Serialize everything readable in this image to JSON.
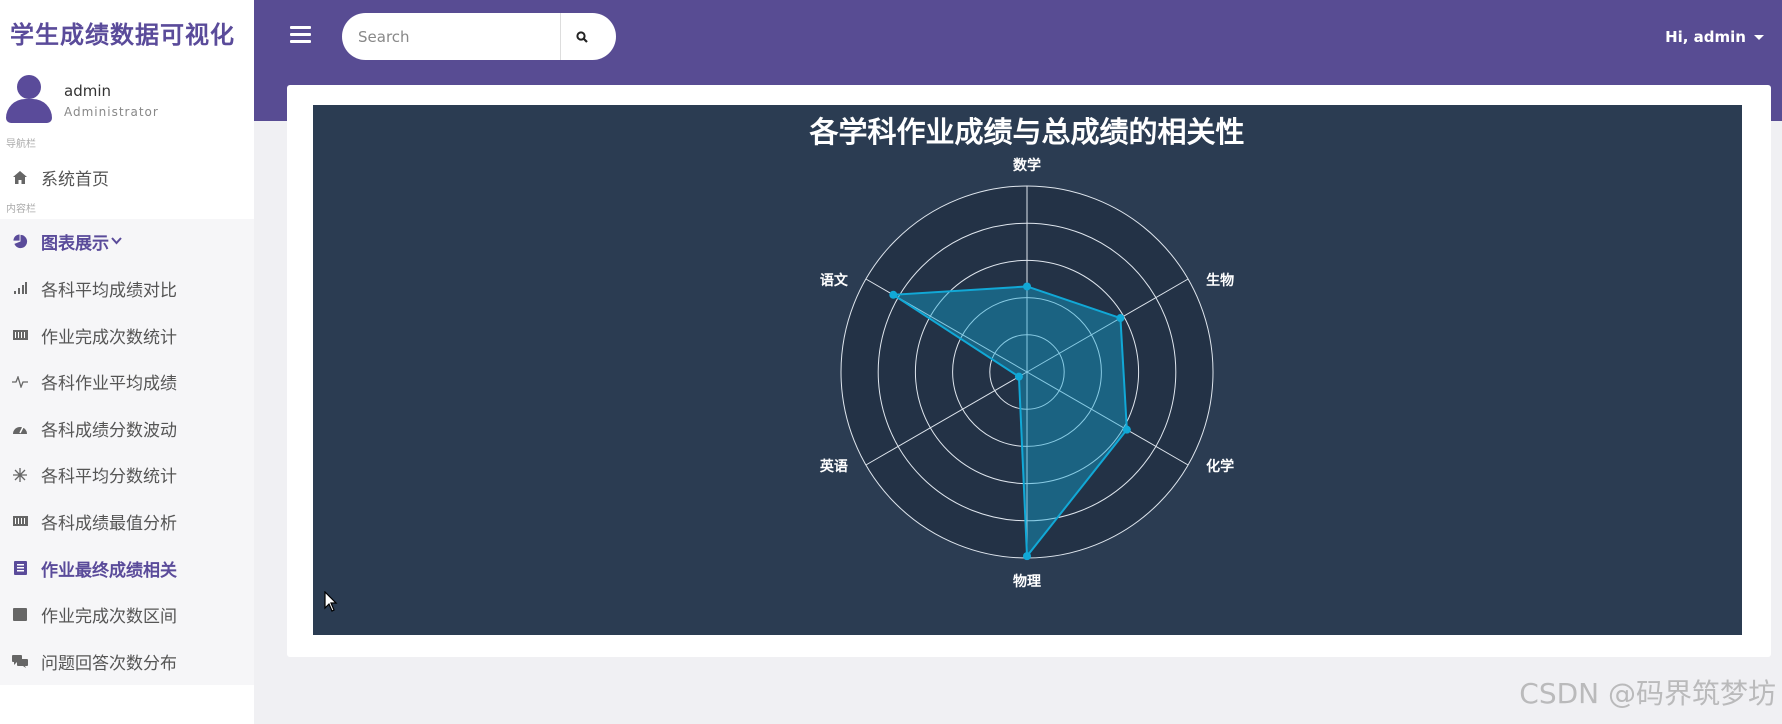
{
  "app": {
    "title": "学生成绩数据可视化"
  },
  "user": {
    "name": "admin",
    "role": "Administrator",
    "greeting": "Hi, admin"
  },
  "sidebar": {
    "section_nav": "导航栏",
    "section_content": "内容栏",
    "home": {
      "label": "系统首页",
      "icon": "home-icon"
    },
    "group": {
      "label": "图表展示",
      "icon": "pie-chart-icon"
    },
    "items": [
      {
        "label": "各科平均成绩对比",
        "icon": "bar-chart-icon"
      },
      {
        "label": "作业完成次数统计",
        "icon": "barcode-icon"
      },
      {
        "label": "各科作业平均成绩",
        "icon": "heartbeat-icon"
      },
      {
        "label": "各科成绩分数波动",
        "icon": "gauge-icon"
      },
      {
        "label": "各科平均分数统计",
        "icon": "snowflake-icon"
      },
      {
        "label": "各科成绩最值分析",
        "icon": "barcode-icon"
      },
      {
        "label": "作业最终成绩相关",
        "icon": "book-icon",
        "active": true
      },
      {
        "label": "作业完成次数区间",
        "icon": "square-icon"
      },
      {
        "label": "问题回答次数分布",
        "icon": "comments-icon"
      }
    ]
  },
  "search": {
    "placeholder": "Search"
  },
  "colors": {
    "brand": "#584c93",
    "chart_bg": "#2b3c52",
    "series": "#11a8d6"
  },
  "chart_data": {
    "type": "radar",
    "title": "各学科作业成绩与总成绩的相关性",
    "indicators": [
      "数学",
      "生物",
      "化学",
      "物理",
      "英语",
      "语文"
    ],
    "max": 1,
    "rings": 5,
    "series": [
      {
        "values": [
          0.46,
          0.58,
          0.62,
          0.99,
          0.05,
          0.83
        ]
      }
    ]
  },
  "watermark": "CSDN @码界筑梦坊"
}
